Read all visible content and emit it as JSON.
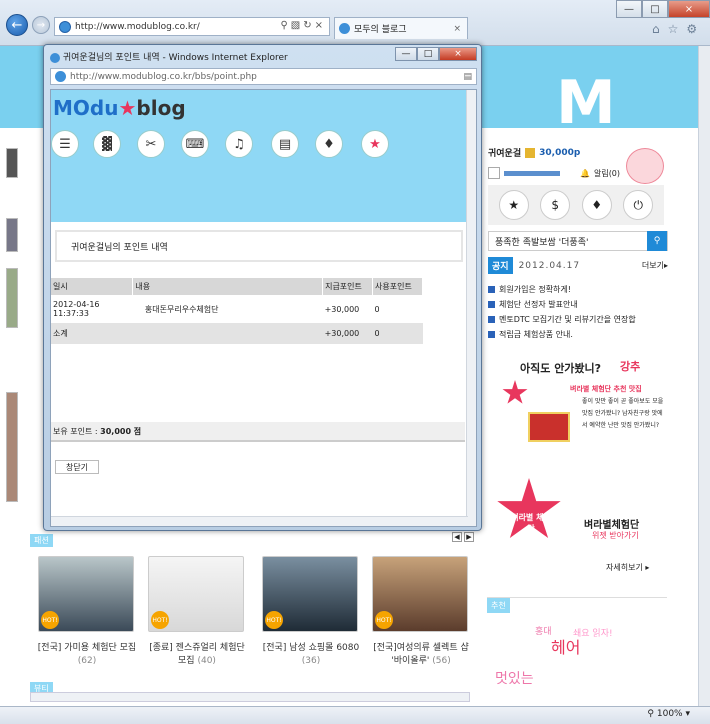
{
  "browser": {
    "address": "http://www.modublog.co.kr/",
    "tab_label": "모두의 블로그",
    "zoom": "100%"
  },
  "page": {
    "user_name": "귀여운걸",
    "user_points": "30,000p",
    "alarm": "알림(0)",
    "search_text": "풍족한 족발보쌈 '더풍족'",
    "notice_badge": "공지",
    "notice_date": "2012.04.17",
    "more": "더보기▸",
    "notices": [
      "회원가입은 정확하게!",
      "체험단 선정자 발표안내",
      "멘토DTC 모집기간 및 리뷰기간을 연장합",
      "적립금 체험상품 안내."
    ],
    "promo1_top": "아직도 안가봤니?",
    "promo1_red": "강추",
    "promo1_sub": "벼라별 체험단 추천 맛집",
    "promo1_text": "좋이 맛만 좋이 곧 좋아보도 모을 맛집 안가봤니? 남자친구랑 맛에서 예약한 난만 맛집 안가봤니?",
    "promo2_title": "벼라별체험단",
    "promo2_sub": "위젯 받아가기",
    "promo2_badge": "벼라별 체험단",
    "promo2_more": "자세히보기 ▸",
    "rec_label": "추천",
    "rec_words": [
      "홍대",
      "쇄요 읽자!",
      "헤어",
      "멋있는"
    ],
    "hot_label": "HOT!",
    "cards": [
      {
        "title": "[전국] 가미용 체험단 모집",
        "count": "(62)"
      },
      {
        "title": "[종료] 젠스쥬얼리 체험단 모집",
        "count": "(40)"
      },
      {
        "title": "[전국] 남성 쇼핑몰 6080",
        "count": "(36)"
      },
      {
        "title": "[전국]여성의류 셀렉트 샵 '바이올루'",
        "count": "(56)"
      }
    ],
    "section_label": "패션",
    "section_label2": "뷰티"
  },
  "popup": {
    "title": "귀여운걸님의 포인트 내역 - Windows Internet Explorer",
    "address": "http://www.modublog.co.kr/bbs/point.php",
    "logo_a": "MOdu",
    "logo_b": "blog",
    "heading": "귀여운걸님의 포인트 내역",
    "columns": [
      "일시",
      "내용",
      "지급포인트",
      "사용포인트"
    ],
    "rows": [
      {
        "date": "2012-04-16 11:37:33",
        "desc": "홍대돈무리우수체험단",
        "given": "+30,000",
        "used": "0"
      }
    ],
    "sum_label": "소계",
    "sum_given": "+30,000",
    "sum_used": "0",
    "balance_label": "보유 포인트 :",
    "balance_value": "30,000 점",
    "close_label": "창닫기"
  },
  "colors": {
    "sky": "#8fd8f5",
    "brand_blue": "#1a5dae",
    "red": "#e8365d"
  }
}
